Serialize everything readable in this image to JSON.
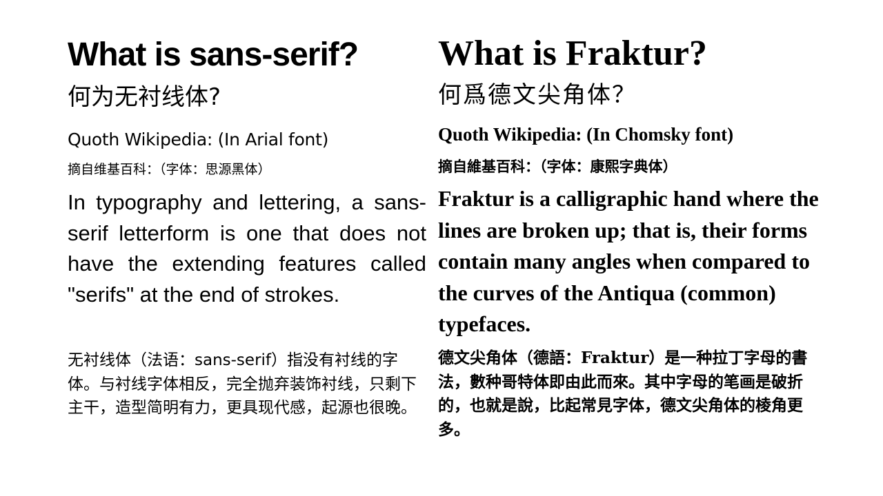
{
  "left": {
    "title": "What is sans-serif?",
    "title_zh": "何为无衬线体?",
    "quoth": "Quoth Wikipedia: (In Arial font)",
    "quoth_zh": "摘自维基百科：（字体：思源黑体）",
    "body": "In typography and lettering, a sans-serif letterform is one that does not have the extending features called \"serifs\" at the end of strokes.",
    "body_zh": "无衬线体（法语：sans-serif）指没有衬线的字体。与衬线字体相反，完全抛弃装饰衬线，只剩下主干，造型简明有力，更具现代感，起源也很晚。"
  },
  "right": {
    "title": "What is Fraktur?",
    "title_zh": "何爲德文尖角体？",
    "quoth": "Quoth Wikipedia: (In Chomsky font)",
    "quoth_zh": "摘自維基百科：（字体：康熙字典体）",
    "body": "Fraktur is a calligraphic hand where the lines are broken up; that is, their forms contain many angles when compared to the curves of the Antiqua (common) typefaces.",
    "body_zh": "德文尖角体（德語：Fraktur）是一种拉丁字母的書法，數种哥特体即由此而來。其中字母的笔画是破折的，也就是說，比起常見字体，德文尖角体的棱角更多。"
  }
}
